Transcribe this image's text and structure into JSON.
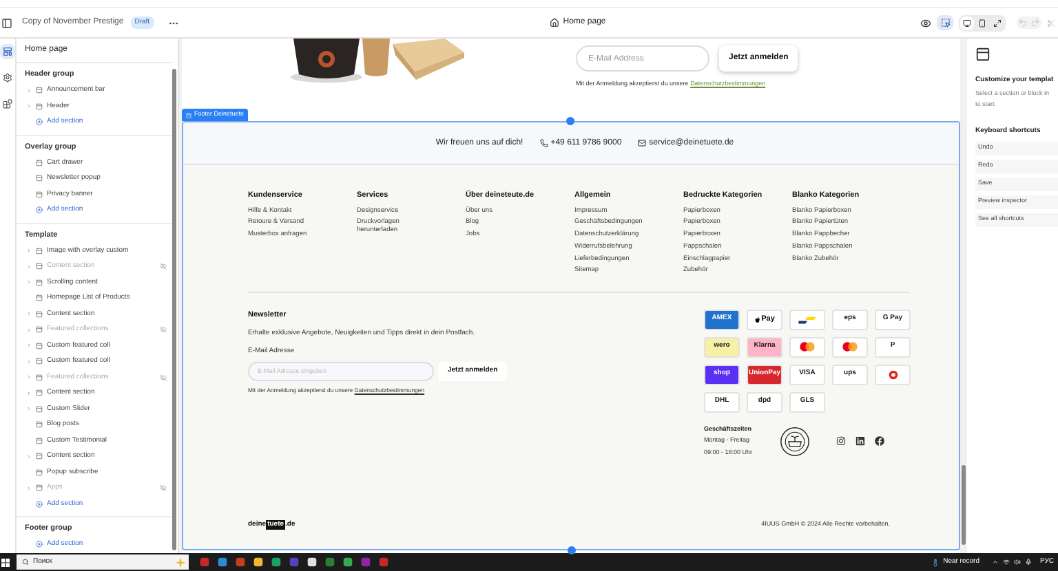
{
  "toolbar": {
    "theme_name": "Copy of November Prestige",
    "badge": "Draft",
    "page": "Home page",
    "inspector_selected": true,
    "devices": [
      {
        "kind": "desktop",
        "selected": true
      },
      {
        "kind": "mobile",
        "selected": false
      },
      {
        "kind": "fullscreen",
        "selected": false
      }
    ],
    "undo_disabled": true
  },
  "rail": [
    {
      "kind": "sections",
      "selected": true
    },
    {
      "kind": "settings",
      "selected": false
    },
    {
      "kind": "apps",
      "selected": false
    }
  ],
  "sidebar": {
    "title": "Home page",
    "groups": [
      {
        "name": "Header group",
        "add_label": "Add section",
        "items": [
          {
            "label": "Announcement bar",
            "expandable": true,
            "hidden": false
          },
          {
            "label": "Header",
            "expandable": true,
            "hidden": false
          }
        ]
      },
      {
        "name": "Overlay group",
        "add_label": "Add section",
        "items": [
          {
            "label": "Cart drawer",
            "expandable": false,
            "hidden": false
          },
          {
            "label": "Newsletter popup",
            "expandable": false,
            "hidden": false
          },
          {
            "label": "Privacy banner",
            "expandable": false,
            "hidden": false
          }
        ]
      },
      {
        "name": "Template",
        "add_label": "Add section",
        "items": [
          {
            "label": "Image with overlay custom",
            "expandable": true,
            "hidden": false
          },
          {
            "label": "Content section",
            "expandable": true,
            "hidden": true
          },
          {
            "label": "Scrolling content",
            "expandable": true,
            "hidden": false
          },
          {
            "label": "Homepage List of Products",
            "expandable": false,
            "hidden": false
          },
          {
            "label": "Content section",
            "expandable": true,
            "hidden": false
          },
          {
            "label": "Featured collections",
            "expandable": true,
            "hidden": true
          },
          {
            "label": "Custom featured coll",
            "expandable": true,
            "hidden": false
          },
          {
            "label": "Custom featured coll",
            "expandable": true,
            "hidden": false
          },
          {
            "label": "Featured collections",
            "expandable": true,
            "hidden": true
          },
          {
            "label": "Content section",
            "expandable": true,
            "hidden": false
          },
          {
            "label": "Custom Slider",
            "expandable": true,
            "hidden": false
          },
          {
            "label": "Blog posts",
            "expandable": false,
            "hidden": false
          },
          {
            "label": "Custom Testimonial",
            "expandable": false,
            "hidden": false
          },
          {
            "label": "Content section",
            "expandable": true,
            "hidden": false
          },
          {
            "label": "Popup subscribe",
            "expandable": false,
            "hidden": false
          },
          {
            "label": "Apps",
            "expandable": true,
            "hidden": true
          }
        ]
      },
      {
        "name": "Footer group",
        "add_label": "Add section"
      }
    ]
  },
  "preview_top": {
    "email_placeholder": "E-Mail Address",
    "button": "Jetzt anmelden",
    "consent": "Mit der Anmeldung akzeptierst du unsere",
    "consent_link": "Datenschutzbestimmungen"
  },
  "footer": {
    "label": "Footer Deinetuete",
    "contact": {
      "greeting": "Wir freuen uns auf dich!",
      "phone": "+49 611 9786 9000",
      "email": "service@deinetuete.de"
    },
    "columns": [
      {
        "heading": "Kundenservice",
        "links": [
          "Hilfe & Kontakt",
          "Retoure & Versand",
          "Musterbox anfragen"
        ]
      },
      {
        "heading": "Services",
        "links": [
          "Designservice",
          "Druckvorlagen herunterladen"
        ]
      },
      {
        "heading": "Über deineteute.de",
        "links": [
          "Über uns",
          "Blog",
          "Jobs"
        ]
      },
      {
        "heading": "Allgemein",
        "links": [
          "Impressum",
          "Geschäftsbedingungen",
          "Datenschutzerklärung",
          "Widerrufsbelehrung",
          "Lieferbedingungen",
          "Sitemap"
        ]
      },
      {
        "heading": "Bedruckte Kategorien",
        "links": [
          "Papierboxen",
          "Papierboxen",
          "Papierboxen",
          "Pappschalen",
          "Einschlagpapier",
          "Zubehör"
        ]
      },
      {
        "heading": "Blanko Kategorien",
        "links": [
          "Blanko Papierboxen",
          "Blanko Papiertüten",
          "Blanko Pappbecher",
          "Blanko Pappschalen",
          "Blanko Zubehör"
        ]
      }
    ],
    "newsletter": {
      "title": "Newsletter",
      "text": "Erhalte exklusive Angebote, Neuigkeiten und Tipps direkt in dein Postfach.",
      "field_label": "E-Mail Adresse",
      "placeholder": "E-Mail Adresse eingeben",
      "button": "Jetzt anmelden",
      "consent": "Mit der Anmeldung akzeptierst du unsere",
      "consent_link": "Datenschutzbestimmungen"
    },
    "payments": [
      {
        "kind": "text",
        "label": "AMEX",
        "color": "#1f72cd"
      },
      {
        "kind": "apple",
        "label": "Pay",
        "color": "#ffffff"
      },
      {
        "kind": "stripes",
        "color": "#ffffff"
      },
      {
        "kind": "text",
        "label": "eps",
        "color": "#ffffff"
      },
      {
        "kind": "text",
        "label": "G Pay",
        "color": "#ffffff"
      },
      {
        "kind": "text",
        "label": "wero",
        "color": "#f7f1a8"
      },
      {
        "kind": "text",
        "label": "Klarna",
        "color": "#ffb3c7"
      },
      {
        "kind": "circles",
        "color": "#ffffff"
      },
      {
        "kind": "circles",
        "color": "#ffffff"
      },
      {
        "kind": "text",
        "label": "P",
        "color": "#ffffff"
      },
      {
        "kind": "text",
        "label": "shop",
        "color": "#5a31f4"
      },
      {
        "kind": "text",
        "label": "UnionPay",
        "color": "#d7282f"
      },
      {
        "kind": "text",
        "label": "VISA",
        "color": "#ffffff"
      },
      {
        "kind": "text",
        "label": "ups",
        "color": "#ffffff"
      },
      {
        "kind": "roundel",
        "color": "#ffffff"
      },
      {
        "kind": "text",
        "label": "DHL",
        "color": "#ffffff"
      },
      {
        "kind": "text",
        "label": "dpd",
        "color": "#ffffff"
      },
      {
        "kind": "text",
        "label": "GLS",
        "color": "#ffffff"
      }
    ],
    "hours": {
      "title": "Geschäftszeiten",
      "lines": [
        "Montag - Freitag",
        "09:00 - 18:00 Uhr"
      ]
    },
    "logo": [
      "deine",
      "tuete",
      ".de"
    ],
    "copyright": "4IUUS GmbH © 2024 Alle Rechte vorbehalten."
  },
  "right_panel": {
    "title": "Customize your templat",
    "text_lines": [
      "Select a section or block in",
      "to start."
    ],
    "shortcuts_title": "Keyboard shortcuts",
    "shortcuts": [
      "Undo",
      "Redo",
      "Save",
      "Preview inspector",
      "See all shortcuts"
    ]
  },
  "taskbar": {
    "search": "Поиск",
    "weather": "Near record",
    "language": "РУС"
  }
}
